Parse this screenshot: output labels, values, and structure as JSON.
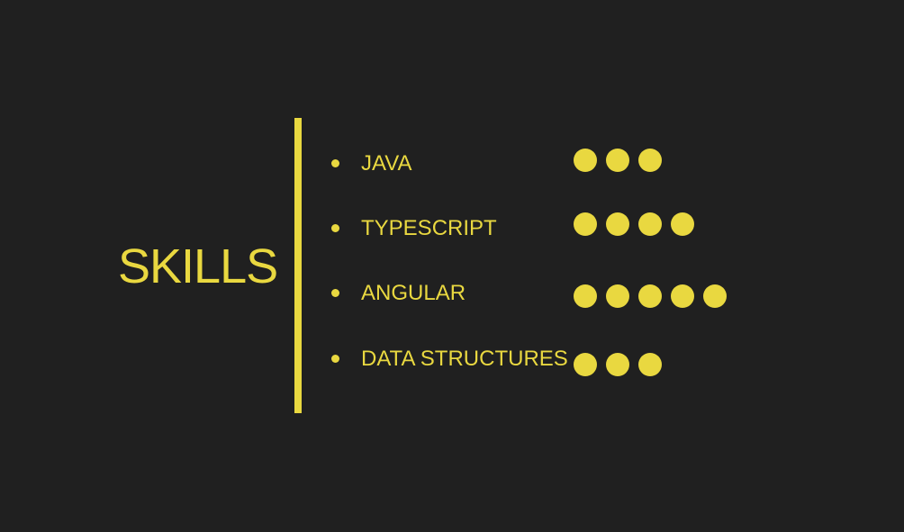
{
  "section": {
    "title": "SKILLS",
    "accent_color": "#e9d840",
    "background_color": "#202020"
  },
  "skills": [
    {
      "name": "JAVA",
      "level": 3
    },
    {
      "name": "TYPESCRIPT",
      "level": 4
    },
    {
      "name": "ANGULAR",
      "level": 5
    },
    {
      "name": "DATA STRUCTURES",
      "level": 3
    }
  ]
}
